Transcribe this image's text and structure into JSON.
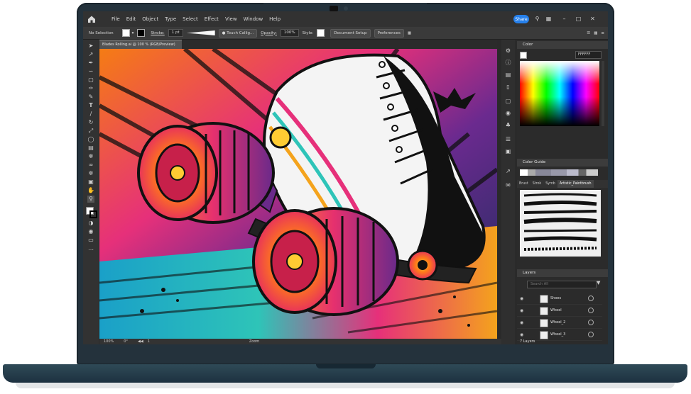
{
  "menubar": {
    "items": [
      "File",
      "Edit",
      "Object",
      "Type",
      "Select",
      "Effect",
      "View",
      "Window",
      "Help"
    ],
    "share_label": "Share"
  },
  "controlbar": {
    "selection": "No Selection",
    "stroke_label": "Stroke:",
    "stroke_value": "1 pt",
    "brush_name": "Touch Callig...",
    "opacity_label": "Opacity:",
    "opacity_value": "100%",
    "style_label": "Style:",
    "document_setup": "Document Setup",
    "preferences": "Preferences"
  },
  "document": {
    "tab_title": "Blades Rolling.ai @ 100 % (RGB/Preview)"
  },
  "statusbar": {
    "zoom": "100%",
    "rotation": "0°",
    "artboard": "1",
    "tool": "Zoom"
  },
  "panels": {
    "color_title": "Color",
    "color_hex": "FFFFFF",
    "color_guide_title": "Color Guide",
    "brush_tabs": [
      "Brust",
      "Strok",
      "Symb",
      "Artistic_Paintbrush"
    ],
    "layers_title": "Layers",
    "layers_search_placeholder": "Search All",
    "layers": [
      "Shoes",
      "Wheel",
      "Wheel_2",
      "Wheel_3"
    ],
    "layers_count": "7 Layers"
  },
  "colors": {
    "accent": "#2680eb",
    "chrome": "#323232",
    "laptop": "#24323c"
  }
}
